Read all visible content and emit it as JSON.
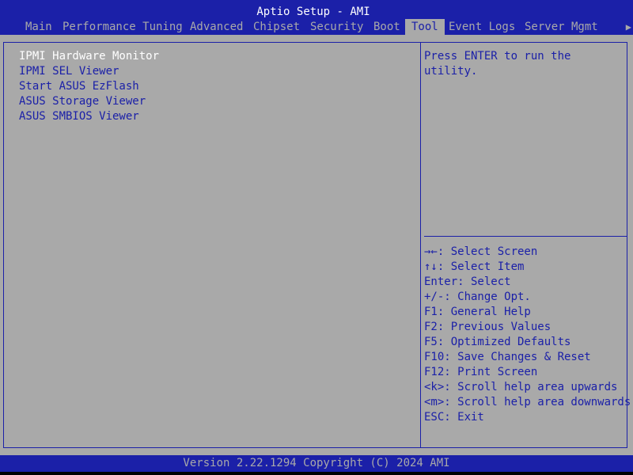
{
  "window": {
    "title": "Aptio Setup - AMI"
  },
  "menu": {
    "tabs": [
      {
        "label": "Main"
      },
      {
        "label": "Performance Tuning"
      },
      {
        "label": "Advanced"
      },
      {
        "label": "Chipset"
      },
      {
        "label": "Security"
      },
      {
        "label": "Boot"
      },
      {
        "label": "Tool"
      },
      {
        "label": "Event Logs"
      },
      {
        "label": "Server Mgmt"
      }
    ],
    "active_tab": "Tool",
    "more_indicator": "▶"
  },
  "tool_menu": {
    "items": [
      {
        "label": "IPMI Hardware Monitor"
      },
      {
        "label": "IPMI SEL Viewer"
      },
      {
        "label": "Start ASUS EzFlash"
      },
      {
        "label": "ASUS Storage Viewer"
      },
      {
        "label": "ASUS SMBIOS Viewer"
      }
    ],
    "selected_item": "IPMI Hardware Monitor"
  },
  "help_panel": {
    "description": "Press ENTER to run the utility.",
    "keys": [
      {
        "text": "→←: Select Screen"
      },
      {
        "text": "↑↓: Select Item"
      },
      {
        "text": "Enter: Select"
      },
      {
        "text": "+/-: Change Opt."
      },
      {
        "text": "F1: General Help"
      },
      {
        "text": "F2: Previous Values"
      },
      {
        "text": "F5: Optimized Defaults"
      },
      {
        "text": "F10: Save Changes & Reset"
      },
      {
        "text": "F12: Print Screen"
      },
      {
        "text": "<k>: Scroll help area upwards"
      },
      {
        "text": "<m>: Scroll help area downwards"
      },
      {
        "text": "ESC: Exit"
      }
    ]
  },
  "footer": {
    "version": "Version 2.22.1294 Copyright (C) 2024 AMI"
  },
  "colors": {
    "background": "#a9a9a9",
    "accent_blue": "#1b20a8",
    "highlight_text": "#ffffff"
  }
}
